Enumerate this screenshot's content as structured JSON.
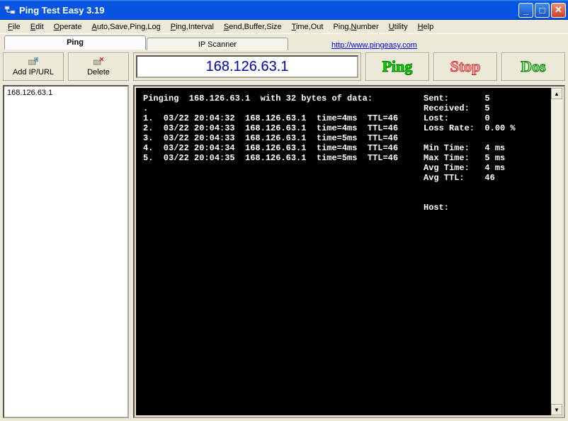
{
  "window": {
    "title": "Ping Test Easy 3.19"
  },
  "menu": {
    "file": "File",
    "edit": "Edit",
    "operate": "Operate",
    "autosave": "Auto,Save,Ping,Log",
    "pinginterval": "Ping,Interval",
    "sendbuffer": "Send,Buffer,Size",
    "timeout": "Time,Out",
    "pingnumber": "Ping,Number",
    "utility": "Utility",
    "help": "Help"
  },
  "tabs": {
    "ping": "Ping",
    "ipscanner": "IP Scanner",
    "website": "http://www.pingeasy.com"
  },
  "toolbar": {
    "addip": "Add IP/URL",
    "delete": "Delete"
  },
  "list": {
    "item0": "168.126.63.1"
  },
  "input": {
    "ip": "168.126.63.1"
  },
  "buttons": {
    "ping": "Ping",
    "stop": "Stop",
    "dos": "Dos"
  },
  "terminal": {
    "header": "Pinging  168.126.63.1  with 32 bytes of data:",
    "dot": ".",
    "l1": "1.  03/22 20:04:32  168.126.63.1  time=4ms  TTL=46",
    "l2": "2.  03/22 20:04:33  168.126.63.1  time=4ms  TTL=46",
    "l3": "3.  03/22 20:04:33  168.126.63.1  time=5ms  TTL=46",
    "l4": "4.  03/22 20:04:34  168.126.63.1  time=4ms  TTL=46",
    "l5": "5.  03/22 20:04:35  168.126.63.1  time=5ms  TTL=46"
  },
  "stats": {
    "sent_l": "Sent:",
    "sent_v": "5",
    "recv_l": "Received:",
    "recv_v": "5",
    "lost_l": "Lost:",
    "lost_v": "0",
    "lossrate_l": "Loss Rate:",
    "lossrate_v": "0.00 %",
    "min_l": "Min Time:",
    "min_v": "4 ms",
    "max_l": "Max Time:",
    "max_v": "5 ms",
    "avg_l": "Avg Time:",
    "avg_v": "4 ms",
    "ttl_l": "Avg TTL:",
    "ttl_v": "46",
    "host_l": "Host:"
  }
}
